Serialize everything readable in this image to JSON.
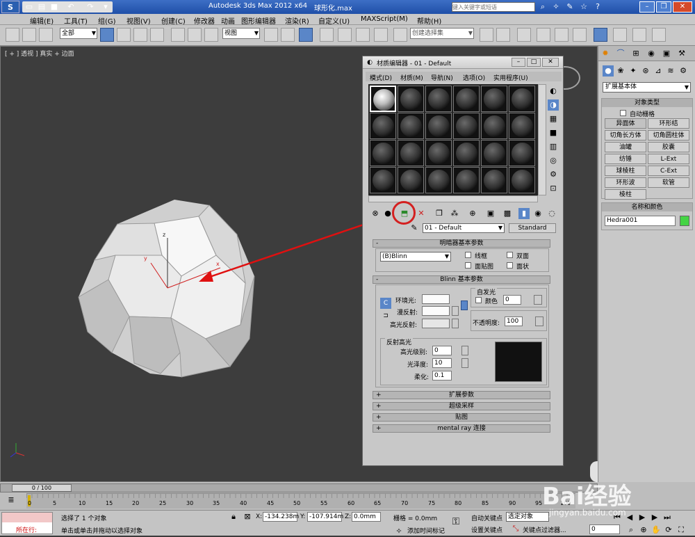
{
  "title_bar": {
    "app_title": "Autodesk 3ds Max  2012 x64",
    "file_name": "球形化.max",
    "search_placeholder": "键入关键字或短语"
  },
  "menu": [
    "编辑(E)",
    "工具(T)",
    "组(G)",
    "视图(V)",
    "创建(C)",
    "修改器",
    "动画",
    "图形编辑器",
    "渲染(R)",
    "自定义(U)",
    "MAXScript(M)",
    "帮助(H)"
  ],
  "toolbar": {
    "selection_filter": "全部",
    "coord_system": "视图",
    "named_selection": "创建选择集"
  },
  "viewport": {
    "label": "[ + ] 透视 ] 真实 + 边面",
    "axis_x": "x",
    "axis_y": "y",
    "axis_z": "z"
  },
  "material_editor": {
    "title": "材质编辑器 - 01 - Default",
    "menu": [
      "模式(D)",
      "材质(M)",
      "导航(N)",
      "选项(O)",
      "实用程序(U)"
    ],
    "material_name": "01 - Default",
    "material_type": "Standard",
    "shader_rollout": {
      "title": "明暗器基本参数",
      "shader": "(B)Blinn",
      "wire": "线框",
      "two_sided": "双面",
      "face_map": "面贴图",
      "faceted": "面状"
    },
    "blinn_rollout": {
      "title": "Blinn 基本参数",
      "self_illum": "自发光",
      "color_label": "颜色",
      "color_value": "0",
      "ambient": "环境光:",
      "diffuse": "漫反射:",
      "specular": "高光反射:",
      "opacity_label": "不透明度:",
      "opacity_value": "100",
      "specular_highlights": "反射高光",
      "spec_level_label": "高光级别:",
      "spec_level": "0",
      "glossiness_label": "光泽度:",
      "glossiness": "10",
      "soften_label": "柔化:",
      "soften": "0.1"
    },
    "rollouts": [
      "扩展参数",
      "超级采样",
      "贴图",
      "mental ray 连接"
    ]
  },
  "command_panel": {
    "category": "扩展基本体",
    "object_type_title": "对象类型",
    "autogrid": "自动栅格",
    "buttons": [
      "异面体",
      "环形结",
      "切角长方体",
      "切角圆柱体",
      "油罐",
      "胶囊",
      "纺锤",
      "L-Ext",
      "球棱柱",
      "C-Ext",
      "环形波",
      "软管",
      "棱柱"
    ],
    "name_color_title": "名称和颜色",
    "object_name": "Hedra001",
    "object_color": "#44d444"
  },
  "timeline": {
    "frame_label": "0 / 100",
    "ticks": [
      "0",
      "5",
      "10",
      "15",
      "20",
      "25",
      "30",
      "35",
      "40",
      "45",
      "50",
      "55",
      "60",
      "65",
      "70",
      "75",
      "80",
      "85",
      "90",
      "95",
      "100"
    ]
  },
  "status": {
    "selected": "选择了 1 个对象",
    "hint": "单击或单击并拖动以选择对象",
    "script_label": "所在行:",
    "x_label": "X:",
    "x_value": "-134.238m",
    "y_label": "Y:",
    "y_value": "-107.914m",
    "z_label": "Z:",
    "z_value": "0.0mm",
    "grid": "栅格 = 0.0mm",
    "auto_key": "自动关键点",
    "selected_obj": "选定对象",
    "set_key": "设置关键点",
    "key_filters": "关键点过滤器...",
    "add_time_tag": "添加时间标记",
    "frame": "0"
  },
  "watermark": {
    "brand": "Bai经验",
    "url": "jingyan.baidu.com"
  },
  "accent": "#d42020"
}
